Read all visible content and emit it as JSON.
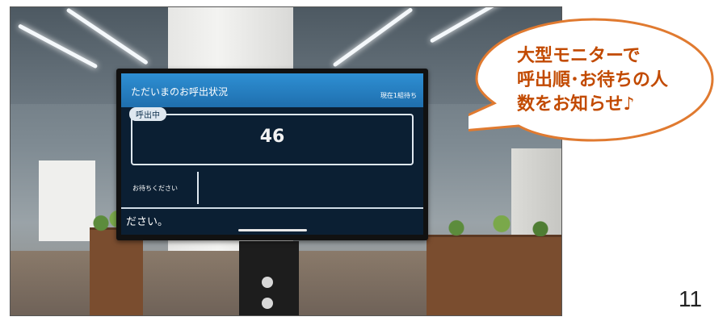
{
  "screen": {
    "header_title": "ただいまのお呼出状況",
    "header_status": "現在1組待ち",
    "calling_badge": "呼出中",
    "calling_number": "46",
    "waiting_label": "お待ちください",
    "ticker_text": "ださい。"
  },
  "callout": {
    "text": "大型モニターで\n呼出順･お待ちの人\n数をお知らせ♪",
    "border_color": "#e07a30",
    "text_color": "#c24a00"
  },
  "slide": {
    "page_number": "11"
  }
}
